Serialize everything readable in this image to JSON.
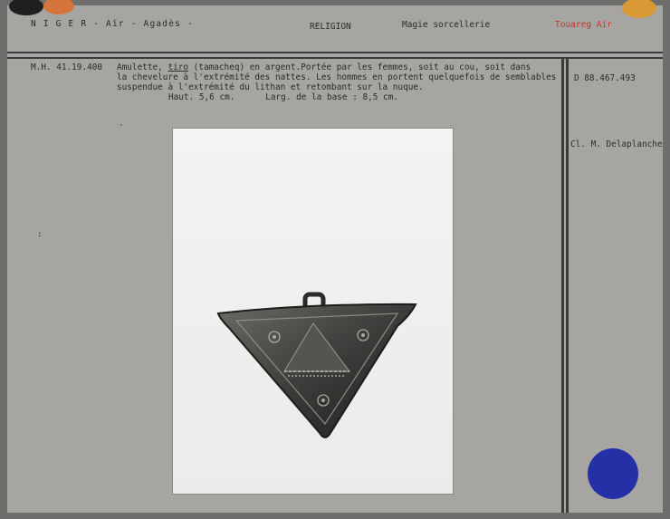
{
  "header": {
    "location": "N I G E R  -  Aïr  -  Agadès  -",
    "category": "RELIGION",
    "subcategory": "Magie sorcellerie",
    "people": "Touareg Aïr"
  },
  "record": {
    "inventory_number": "M.H. 41.19.400",
    "description_line1_prefix": "Amulette, ",
    "description_term": "tiro",
    "description_line1_suffix": " (tamacheq) en argent.Portée par les femmes, soit au cou, soit dans",
    "description_line2": "la chevelure à l'extrémité des nattes. Les hommes en portent quelquefois de semblables",
    "description_line3": "suspendue à l'extrémité du lithan et retombant sur la nuque.",
    "dimensions": "Haut. 5,6 cm.      Larg. de la base : 8,5 cm."
  },
  "side": {
    "photo_reference": "D 88.467.493",
    "photo_credit": "Cl. M. Delaplanche"
  },
  "colors": {
    "card": "#a7a5a2",
    "rules": "#3b3b3b",
    "accent_red": "#c0392b",
    "blue_sticker": "#2530a6",
    "orange_sticker": "#d4743a",
    "yellow_sticker": "#d99a35"
  }
}
